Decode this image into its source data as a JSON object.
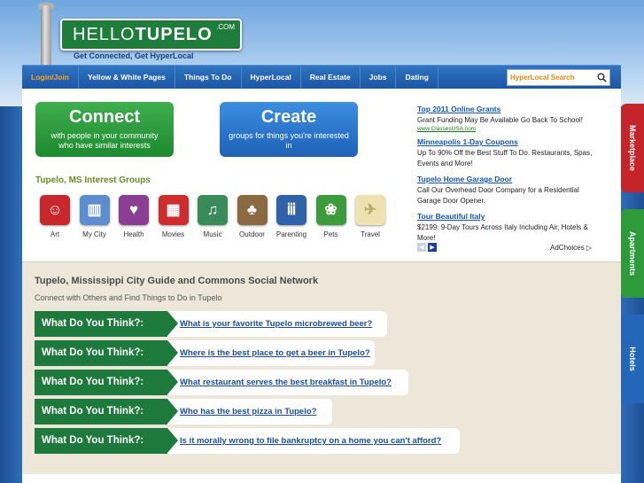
{
  "header": {
    "logo_main": "HELLO",
    "logo_bold": "TUPELO",
    "logo_suffix": ".COM",
    "tagline": "Get Connected, Get HyperLocal"
  },
  "nav": {
    "items": [
      "Login/Join",
      "Yellow & White Pages",
      "Things To Do",
      "HyperLocal",
      "Real Estate",
      "Jobs",
      "Dating"
    ],
    "search_placeholder": "HyperLocal Search"
  },
  "hero": {
    "connect_title": "Connect",
    "connect_sub": "with people in your community who have similar interests",
    "create_title": "Create",
    "create_sub": "groups for things you're interested in"
  },
  "groups": {
    "heading": "Tupelo, MS Interest Groups",
    "items": [
      {
        "label": "Art",
        "icon": "theater-masks-icon",
        "color": "#c8282c",
        "glyph": "☺"
      },
      {
        "label": "My City",
        "icon": "city-icon",
        "color": "#5c8ecf",
        "glyph": "▥"
      },
      {
        "label": "Health",
        "icon": "heart-monitor-icon",
        "color": "#8a3f93",
        "glyph": "♥"
      },
      {
        "label": "Movies",
        "icon": "film-icon",
        "color": "#cf2d2d",
        "glyph": "▦"
      },
      {
        "label": "Music",
        "icon": "music-note-icon",
        "color": "#3a8a5a",
        "glyph": "♫"
      },
      {
        "label": "Outdoor",
        "icon": "tree-icon",
        "color": "#8a6a40",
        "glyph": "♣"
      },
      {
        "label": "Parenting",
        "icon": "family-icon",
        "color": "#2f62a8",
        "glyph": "ⅲ"
      },
      {
        "label": "Pets",
        "icon": "paw-icon",
        "color": "#3d9a3d",
        "glyph": "❀"
      },
      {
        "label": "Travel",
        "icon": "airplane-icon",
        "color": "#ede2b0",
        "glyph": "✈"
      }
    ]
  },
  "ads": {
    "items": [
      {
        "title": "Top 2011 Online Grants",
        "text": "Grant Funding May Be Available Go Back To School!",
        "url": "www.ClassesUSA.com"
      },
      {
        "title": "Minneapolis 1-Day Coupons",
        "text": "Up To 90% Off the Best Stuff To Do. Restaurants, Spas, Events and More!",
        "url": ""
      },
      {
        "title": "Tupelo Home Garage Door",
        "text": "Call Our Overhead Door Company for a Residential Garage Door Opener.",
        "url": ""
      },
      {
        "title": "Tour Beautiful Italy",
        "text": "$2199: 9-Day Tours Across Italy Including Air, Hotels & More!",
        "url": ""
      }
    ],
    "adchoices": "AdChoices"
  },
  "lower": {
    "title": "Tupelo, Mississippi City Guide and Commons Social Network",
    "subtitle": "Connect with Others and Find Things to Do in Tupelo",
    "question_label": "What Do You Think?:",
    "questions": [
      "What is your favorite Tupelo microbrewed beer?",
      "Where is the best place to get a beer in Tupelo?",
      "What restaurant serves the best breakfast in Tupelo?",
      "Who has the best pizza in Tupelo?",
      "Is it morally wrong to file bankruptcy on a home you can't afford?"
    ]
  },
  "side_tabs": [
    "Marketplace",
    "Apartments",
    "Hotels"
  ]
}
